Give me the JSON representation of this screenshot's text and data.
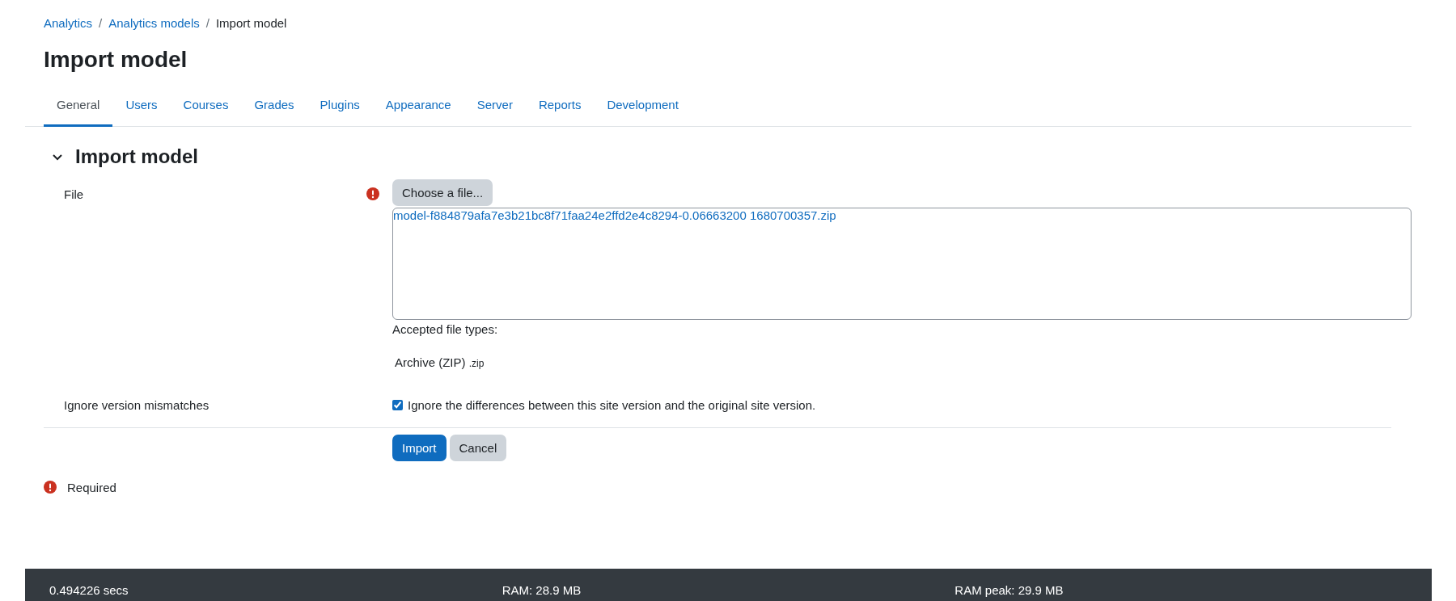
{
  "breadcrumb": [
    {
      "label": "Analytics",
      "link": true
    },
    {
      "label": "Analytics models",
      "link": true
    },
    {
      "label": "Import model",
      "link": false
    }
  ],
  "breadcrumb_separator": "/",
  "title": "Import model",
  "tabs": [
    {
      "label": "General",
      "selected": true
    },
    {
      "label": "Users",
      "selected": false
    },
    {
      "label": "Courses",
      "selected": false
    },
    {
      "label": "Grades",
      "selected": false
    },
    {
      "label": "Plugins",
      "selected": false
    },
    {
      "label": "Appearance",
      "selected": false
    },
    {
      "label": "Server",
      "selected": false
    },
    {
      "label": "Reports",
      "selected": false
    },
    {
      "label": "Development",
      "selected": false
    }
  ],
  "section": {
    "title": "Import model",
    "expanded": true
  },
  "file_field": {
    "label": "File",
    "required": true,
    "button": "Choose a file...",
    "file_name": "model-f884879afa7e3b21bc8f71faa24e2ffd2e4c8294-0.06663200 1680700357.zip",
    "accepted_label": "Accepted file types:",
    "type_name": "Archive (ZIP)",
    "type_ext": ".zip"
  },
  "ignore_field": {
    "label": "Ignore version mismatches",
    "checked": true,
    "text": "Ignore the differences between this site version and the original site version."
  },
  "buttons": [
    {
      "label": "Import",
      "kind": "primary"
    },
    {
      "label": "Cancel",
      "kind": "secondary"
    }
  ],
  "required_note": "Required",
  "footer": [
    "0.494226 secs",
    "RAM: 28.9 MB",
    "RAM peak: 29.9 MB"
  ]
}
